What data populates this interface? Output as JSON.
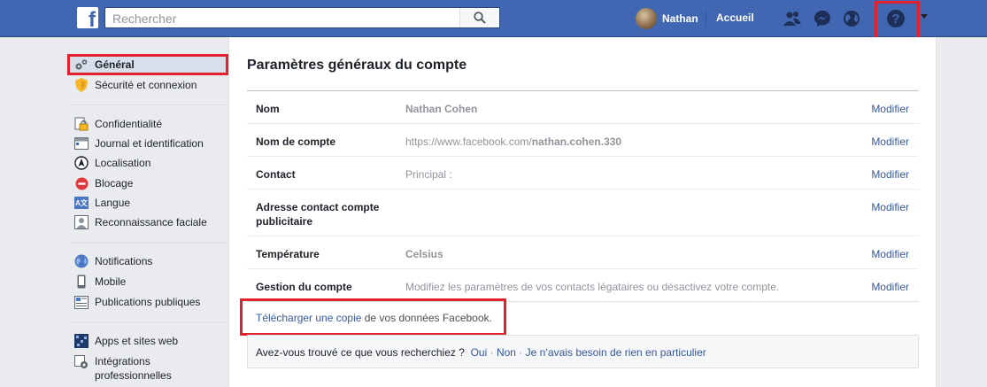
{
  "topbar": {
    "logo": "f",
    "search_placeholder": "Rechercher",
    "user_name": "Nathan",
    "home_label": "Accueil",
    "icons": [
      "friends-icon",
      "messenger-icon",
      "notifications-globe-icon",
      "help-icon",
      "menu-caret-icon"
    ]
  },
  "sidebar": {
    "items": [
      {
        "label": "Général",
        "icon": "gear-icon",
        "active": true
      },
      {
        "label": "Sécurité et connexion",
        "icon": "shield-icon"
      },
      {
        "label": "Confidentialité",
        "icon": "lock-icon"
      },
      {
        "label": "Journal et identification",
        "icon": "timeline-icon"
      },
      {
        "label": "Localisation",
        "icon": "location-icon"
      },
      {
        "label": "Blocage",
        "icon": "block-icon"
      },
      {
        "label": "Langue",
        "icon": "language-icon"
      },
      {
        "label": "Reconnaissance faciale",
        "icon": "face-icon"
      },
      {
        "label": "Notifications",
        "icon": "globe-icon"
      },
      {
        "label": "Mobile",
        "icon": "mobile-icon"
      },
      {
        "label": "Publications publiques",
        "icon": "feed-icon"
      },
      {
        "label": "Apps et sites web",
        "icon": "apps-icon"
      },
      {
        "label": "Intégrations professionnelles",
        "icon": "integrations-icon"
      }
    ]
  },
  "main": {
    "title": "Paramètres généraux du compte",
    "rows": [
      {
        "label": "Nom",
        "value": "Nathan Cohen",
        "value_bold": true,
        "edit": "Modifier"
      },
      {
        "label": "Nom de compte",
        "value_prefix": "https://www.facebook.com/",
        "value_suffix": "nathan.cohen.330",
        "edit": "Modifier"
      },
      {
        "label": "Contact",
        "value": "Principal :",
        "edit": "Modifier"
      },
      {
        "label": "Adresse contact compte publicitaire",
        "value": "",
        "edit": "Modifier"
      },
      {
        "label": "Température",
        "value": "Celsius",
        "value_bold": true,
        "edit": "Modifier"
      },
      {
        "label": "Gestion du compte",
        "value": "Modifiez les paramètres de vos contacts légataires ou désactivez votre compte.",
        "edit": "Modifier"
      }
    ],
    "download": {
      "link": "Télécharger une copie",
      "rest": " de vos données Facebook."
    },
    "feedback": {
      "question": "Avez-vous trouvé ce que vous recherchiez ?",
      "yes": "Oui",
      "no": "Non",
      "other": "Je n’avais besoin de rien en particulier",
      "sep": " · "
    }
  },
  "colors": {
    "topbar": "#4267b2",
    "link": "#365899",
    "highlight": "#e3202e"
  }
}
